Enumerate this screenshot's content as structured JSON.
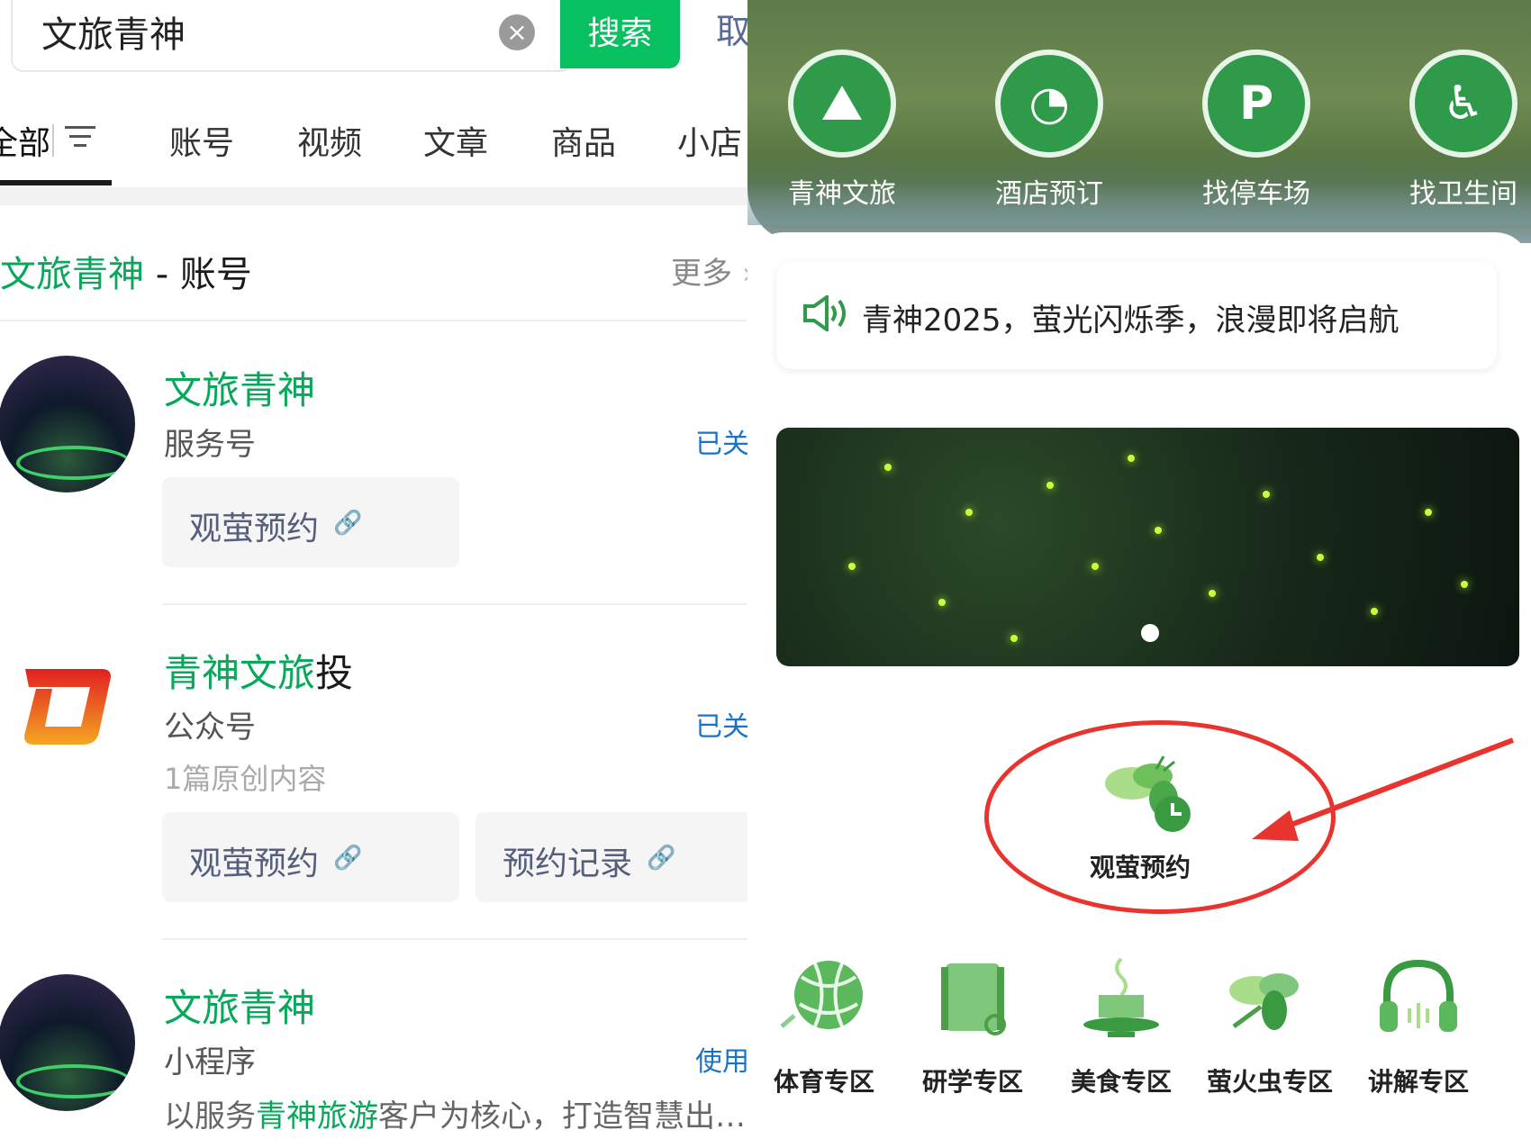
{
  "search": {
    "query": "文旅青神",
    "button": "搜索",
    "cancel": "取消"
  },
  "tabs": [
    "全部",
    "账号",
    "视频",
    "文章",
    "商品",
    "小店"
  ],
  "section": {
    "title_highlight": "文旅青神",
    "title_rest": " - 账号",
    "more": "更多"
  },
  "results": [
    {
      "name": "文旅青神",
      "type": "服务号",
      "status": "已关注",
      "links": [
        "观萤预约"
      ]
    },
    {
      "name_highlight": "青神文旅",
      "name_rest": "投",
      "type": "公众号",
      "meta": "1篇原创内容",
      "status": "已关注",
      "links": [
        "观萤预约",
        "预约记录"
      ]
    },
    {
      "name": "文旅青神",
      "type": "小程序",
      "status": "使用过",
      "desc_pre": "以服务",
      "desc_highlight": "青神旅游",
      "desc_post": "客户为核心，打造智慧出…"
    }
  ],
  "quick_icons": [
    {
      "label": "青神文旅",
      "icon": "mountain-icon"
    },
    {
      "label": "酒店预订",
      "icon": "clock-hand-icon"
    },
    {
      "label": "找停车场",
      "icon": "parking-icon"
    },
    {
      "label": "找卫生间",
      "icon": "restroom-icon"
    }
  ],
  "notice": "青神2025，萤光闪烁季，浪漫即将启航",
  "featured": {
    "label": "观萤预约",
    "icon": "firefly-clock-icon"
  },
  "zones": [
    {
      "label": "体育专区",
      "icon": "ball-icon"
    },
    {
      "label": "研学专区",
      "icon": "scroll-icon"
    },
    {
      "label": "美食专区",
      "icon": "food-icon"
    },
    {
      "label": "萤火虫专区",
      "icon": "firefly-icon"
    },
    {
      "label": "讲解专区",
      "icon": "headphones-icon"
    }
  ],
  "colors": {
    "accent": "#07c160",
    "highlight": "#07a85a",
    "link": "#1a73c9",
    "annotation": "#e8332f"
  }
}
